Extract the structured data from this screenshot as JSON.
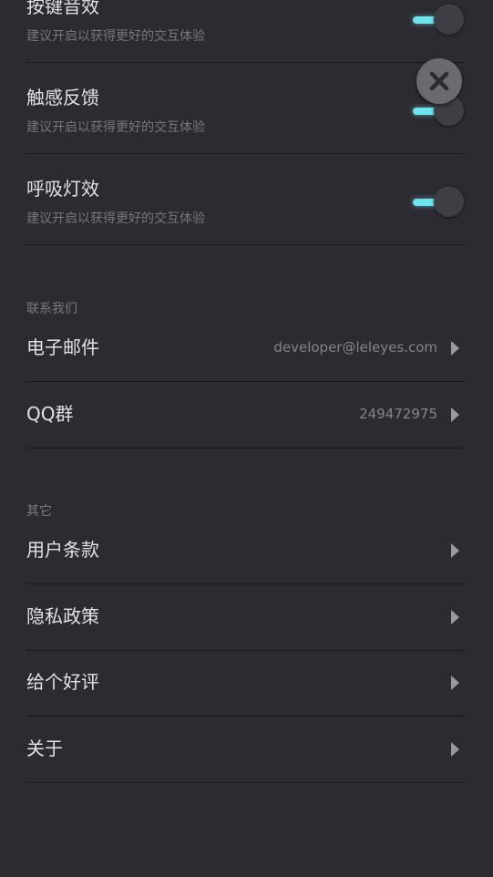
{
  "settings": {
    "key_sound": {
      "title": "按键音效",
      "subtitle": "建议开启以获得更好的交互体验",
      "enabled": true
    },
    "haptic": {
      "title": "触感反馈",
      "subtitle": "建议开启以获得更好的交互体验",
      "enabled": true
    },
    "breathing_light": {
      "title": "呼吸灯效",
      "subtitle": "建议开启以获得更好的交互体验",
      "enabled": true
    }
  },
  "contact": {
    "header": "联系我们",
    "email": {
      "label": "电子邮件",
      "value": "developer@leleyes.com"
    },
    "qq": {
      "label": "QQ群",
      "value": "249472975"
    }
  },
  "other": {
    "header": "其它",
    "items": [
      {
        "label": "用户条款"
      },
      {
        "label": "隐私政策"
      },
      {
        "label": "给个好评"
      },
      {
        "label": "关于"
      }
    ]
  },
  "icons": {
    "close": "close-icon",
    "chevron": "chevron-right-icon"
  },
  "colors": {
    "background": "#2c2b31",
    "accent": "#6fe3ec"
  }
}
